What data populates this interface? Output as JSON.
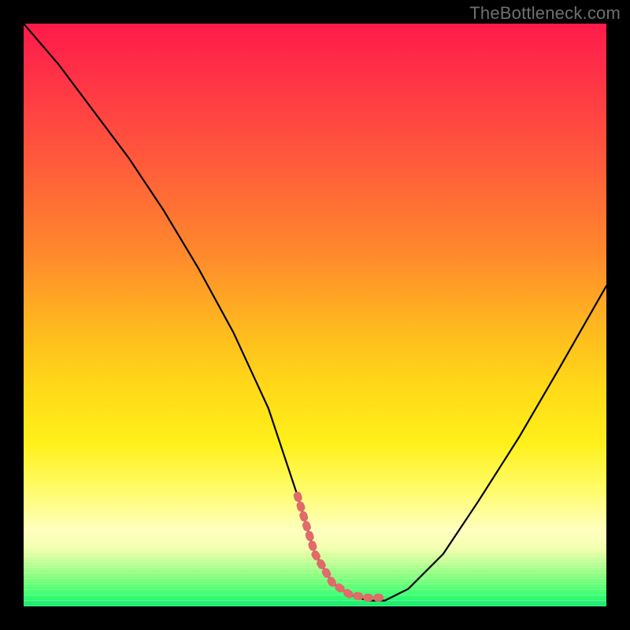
{
  "watermark": "TheBottleneck.com",
  "chart_data": {
    "type": "line",
    "title": "",
    "xlabel": "",
    "ylabel": "",
    "xlim": [
      0,
      100
    ],
    "ylim": [
      0,
      100
    ],
    "grid": false,
    "series": [
      {
        "name": "bottleneck-curve",
        "x": [
          0,
          6,
          12,
          18,
          24,
          30,
          36,
          42,
          47,
          50,
          53,
          56,
          59,
          62,
          66,
          72,
          78,
          85,
          92,
          100
        ],
        "values": [
          100,
          93,
          85,
          77,
          68,
          58,
          47,
          34,
          19,
          9,
          4,
          2,
          1,
          1,
          3,
          9,
          18,
          29,
          41,
          55
        ]
      }
    ],
    "annotations": [
      {
        "name": "bottom-highlight-dots",
        "x_start": 47,
        "x_end": 62,
        "y": 1.5
      }
    ],
    "colors": {
      "curve": "#000000",
      "bottom_highlight": "#e16a6a",
      "gradient_top": "#ff1a4b",
      "gradient_bottom": "#18e86e"
    }
  }
}
